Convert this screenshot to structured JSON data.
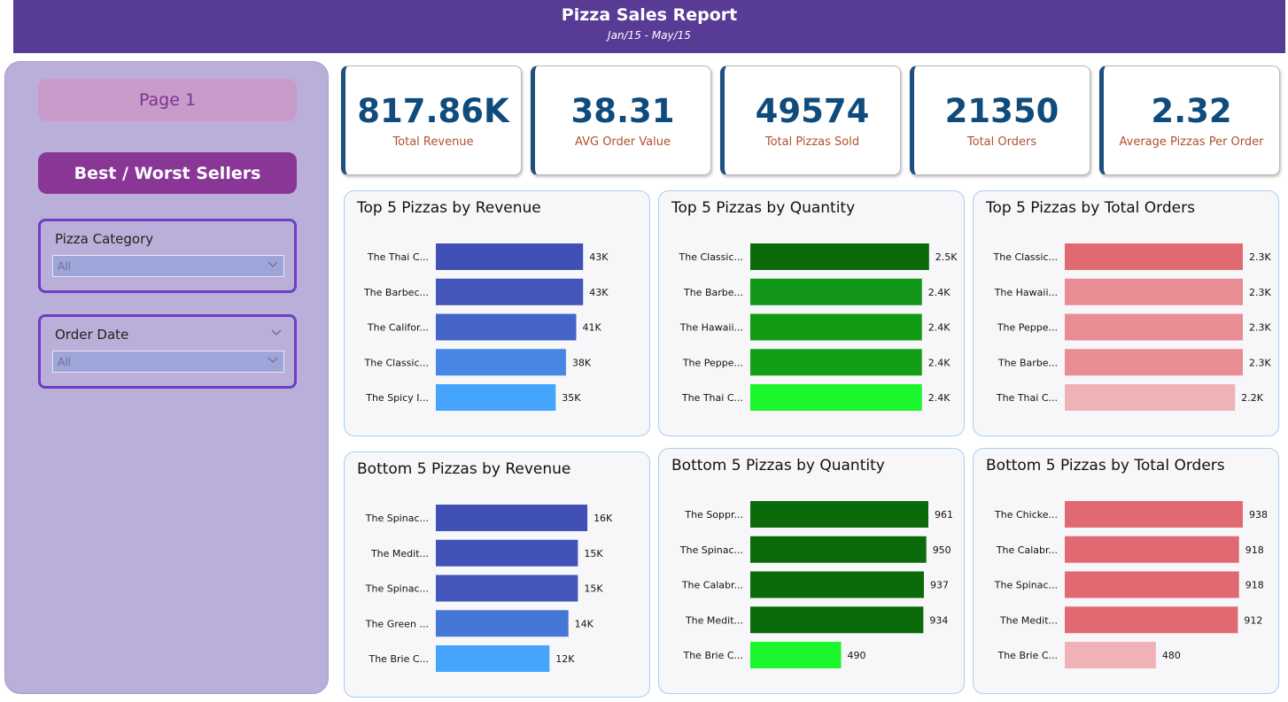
{
  "header": {
    "title": "Pizza Sales Report",
    "subtitle": "Jan/15 - May/15"
  },
  "sidebar": {
    "page_button": "Page 1",
    "nav_button": "Best / Worst Sellers",
    "category_slicer": {
      "label": "Pizza Category",
      "value": "All"
    },
    "date_slicer": {
      "label": "Order Date",
      "value": "All"
    }
  },
  "kpis": [
    {
      "value": "817.86K",
      "label": "Total Revenue"
    },
    {
      "value": "38.31",
      "label": "AVG Order Value"
    },
    {
      "value": "49574",
      "label": "Total Pizzas Sold"
    },
    {
      "value": "21350",
      "label": "Total Orders"
    },
    {
      "value": "2.32",
      "label": "Average Pizzas Per Order"
    }
  ],
  "chart_data": [
    {
      "type": "bar",
      "orientation": "horizontal",
      "title": "Top 5 Pizzas by Revenue",
      "categories": [
        "The Thai C...",
        "The Barbec...",
        "The Califor...",
        "The Classic...",
        "The Spicy I..."
      ],
      "values": [
        43,
        43,
        41,
        38,
        35
      ],
      "labels": [
        "43K",
        "43K",
        "41K",
        "38K",
        "35K"
      ],
      "colors": [
        "#4150b5",
        "#4356b9",
        "#4464c8",
        "#4786e4",
        "#45a4fb"
      ],
      "xmax": 52
    },
    {
      "type": "bar",
      "orientation": "horizontal",
      "title": "Top 5 Pizzas by Quantity",
      "categories": [
        "The Classic...",
        "The Barbe...",
        "The Hawaii...",
        "The Peppe...",
        "The Thai C..."
      ],
      "values": [
        2.5,
        2.4,
        2.4,
        2.4,
        2.4
      ],
      "labels": [
        "2.5K",
        "2.4K",
        "2.4K",
        "2.4K",
        "2.4K"
      ],
      "colors": [
        "#0b6b0b",
        "#11961a",
        "#119b15",
        "#129f17",
        "#1bf52c"
      ],
      "xmax": 2.49
    },
    {
      "type": "bar",
      "orientation": "horizontal",
      "title": "Top 5 Pizzas by Total Orders",
      "categories": [
        "The Classic...",
        "The Hawaii...",
        "The Peppe...",
        "The Barbe...",
        "The Thai C..."
      ],
      "values": [
        2.3,
        2.3,
        2.3,
        2.3,
        2.2
      ],
      "labels": [
        "2.3K",
        "2.3K",
        "2.3K",
        "2.3K",
        "2.2K"
      ],
      "colors": [
        "#e16a72",
        "#e88d93",
        "#e88d93",
        "#e88d93",
        "#efb2b7"
      ],
      "xmax": 2.3
    },
    {
      "type": "bar",
      "orientation": "horizontal",
      "title": "Bottom 5 Pizzas by Revenue",
      "categories": [
        "The Spinac...",
        "The Medit...",
        "The Spinac...",
        "The Green ...",
        "The Brie C..."
      ],
      "values": [
        16,
        15,
        15,
        14,
        12
      ],
      "labels": [
        "16K",
        "15K",
        "15K",
        "14K",
        "12K"
      ],
      "colors": [
        "#4150b5",
        "#4253b7",
        "#4356ba",
        "#4577d6",
        "#45a4fb"
      ],
      "xmax": 18.8
    },
    {
      "type": "bar",
      "orientation": "horizontal",
      "title": "Bottom 5 Pizzas by Quantity",
      "categories": [
        "The Soppr...",
        "The Spinac...",
        "The Calabr...",
        "The Medit...",
        "The Brie C..."
      ],
      "values": [
        961,
        950,
        937,
        934,
        490
      ],
      "labels": [
        "961",
        "950",
        "937",
        "934",
        "490"
      ],
      "colors": [
        "#0b6b0b",
        "#0b6b0b",
        "#0b6b0b",
        "#0b6b0b",
        "#1bf52c"
      ],
      "xmax": 961
    },
    {
      "type": "bar",
      "orientation": "horizontal",
      "title": "Bottom 5 Pizzas by Total Orders",
      "categories": [
        "The Chicke...",
        "The Calabr...",
        "The Spinac...",
        "The Medit...",
        "The Brie C..."
      ],
      "values": [
        938,
        918,
        918,
        912,
        480
      ],
      "labels": [
        "938",
        "918",
        "918",
        "912",
        "480"
      ],
      "colors": [
        "#e16a72",
        "#e16a72",
        "#e16a72",
        "#e16a72",
        "#efb2b7"
      ],
      "xmax": 938
    }
  ]
}
